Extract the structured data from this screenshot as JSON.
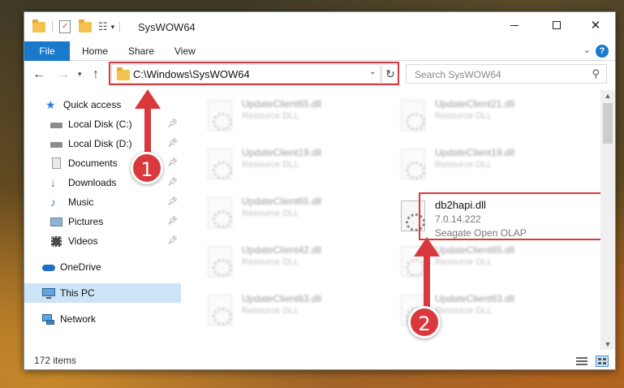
{
  "window": {
    "title": "SysWOW64"
  },
  "titlebar": {
    "minimize_icon": "minimize-icon",
    "maximize_icon": "maximize-icon",
    "close_icon": "close-icon"
  },
  "ribbon": {
    "tabs": [
      "File",
      "Home",
      "Share",
      "View"
    ],
    "help_glyph": "?"
  },
  "address": {
    "path": "C:\\Windows\\SysWOW64"
  },
  "search": {
    "placeholder": "Search SysWOW64"
  },
  "sidebar": {
    "items": [
      {
        "label": "Quick access",
        "icon": "star-icon"
      },
      {
        "label": "Local Disk (C:)",
        "icon": "drive-icon",
        "pinned": true
      },
      {
        "label": "Local Disk (D:)",
        "icon": "drive-icon",
        "pinned": true
      },
      {
        "label": "Documents",
        "icon": "documents-icon",
        "pinned": true
      },
      {
        "label": "Downloads",
        "icon": "download-icon",
        "pinned": true
      },
      {
        "label": "Music",
        "icon": "music-icon",
        "pinned": true
      },
      {
        "label": "Pictures",
        "icon": "pictures-icon",
        "pinned": true
      },
      {
        "label": "Videos",
        "icon": "videos-icon",
        "pinned": true
      },
      {
        "label": "OneDrive",
        "icon": "cloud-icon"
      },
      {
        "label": "This PC",
        "icon": "computer-icon",
        "selected": true
      },
      {
        "label": "Network",
        "icon": "network-icon"
      }
    ]
  },
  "files": {
    "left_column": [
      {
        "name": "UpdateClient65.dll",
        "desc": "Resource DLL"
      },
      {
        "name": "UpdateClient19.dll",
        "desc": "Resource DLL"
      },
      {
        "name": "UpdateClient65.dll",
        "desc": "Resource DLL"
      },
      {
        "name": "UpdateClient42.dll",
        "desc": "Resource DLL"
      },
      {
        "name": "UpdateClient63.dll",
        "desc": "Resource DLL"
      }
    ],
    "right_column": [
      {
        "name": "UpdateClient21.dll",
        "desc": "Resource DLL"
      },
      {
        "name": "UpdateClient19.dll",
        "desc": "Resource DLL"
      },
      {
        "name": "UpdateClient65.dll",
        "desc": "Resource DLL"
      },
      {
        "name": "UpdateClient63.dll",
        "desc": "Resource DLL"
      }
    ],
    "highlighted": {
      "name": "db2hapi.dll",
      "version": "7.0.14.222",
      "company": "Seagate Open OLAP"
    }
  },
  "status": {
    "items_count": "172 items"
  },
  "annotations": {
    "step1": "1",
    "step2": "2",
    "accent_color": "#d9393c"
  }
}
